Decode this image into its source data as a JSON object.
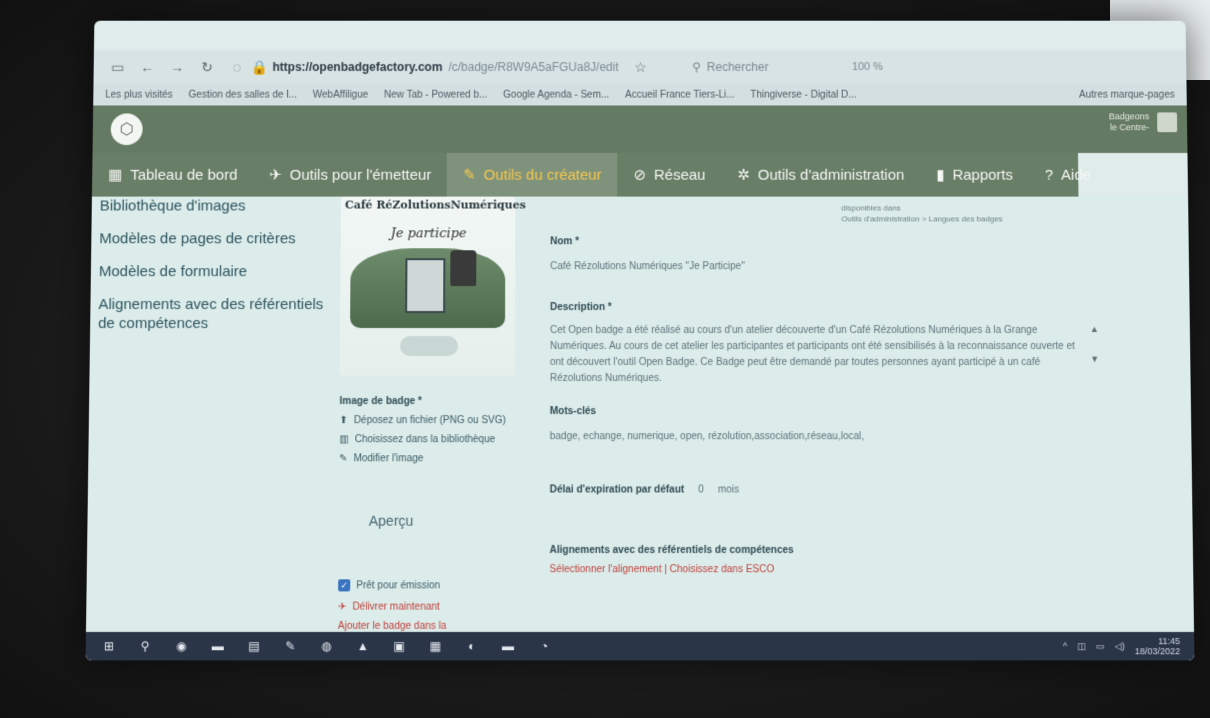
{
  "browser": {
    "url_host": "https://openbadgefactory.com",
    "url_path": "/c/badge/R8W9A5aFGUa8J/edit",
    "search_placeholder": "Rechercher",
    "zoom": "100 %",
    "bookmarks": [
      "Les plus visités",
      "Gestion des salles de l...",
      "WebAffiligue",
      "New Tab - Powered b...",
      "Google Agenda - Sem...",
      "Accueil France Tiers-Li...",
      "Thingiverse - Digital D..."
    ],
    "bookmarks_more": "Autres marque-pages"
  },
  "app": {
    "user_line1": "Badgeons",
    "user_line2": "le Centre-"
  },
  "nav": [
    {
      "icon": "▦",
      "label": "Tableau de bord",
      "active": false
    },
    {
      "icon": "✈",
      "label": "Outils pour l'émetteur",
      "active": false
    },
    {
      "icon": "✎",
      "label": "Outils du créateur",
      "active": true
    },
    {
      "icon": "⊘",
      "label": "Réseau",
      "active": false
    },
    {
      "icon": "✲",
      "label": "Outils d'administration",
      "active": false
    },
    {
      "icon": "▮",
      "label": "Rapports",
      "active": false
    },
    {
      "icon": "?",
      "label": "Aide",
      "active": false
    }
  ],
  "sidebar": [
    "Bibliothèque d'images",
    "Modèles de pages de critères",
    "Modèles de formulaire",
    "Alignements avec des référentiels de compétences"
  ],
  "badge": {
    "title": "Café RéZolutionsNumériques",
    "subtitle": "Je participe",
    "image_label": "Image de badge *",
    "upload": "Déposez un fichier (PNG ou SVG)",
    "library": "Choisissez dans la bibliothèque",
    "edit": "Modifier l'image",
    "preview": "Aperçu",
    "ready": "Prêt pour émission",
    "deliver": "Délivrer maintenant",
    "add": "Ajouter le badge dans la"
  },
  "form": {
    "note1": "disponibles dans",
    "note2": "Outils d'administration > Langues des badges",
    "name_label": "Nom *",
    "name_value": "Café Rézolutions Numériques \"Je Participe\"",
    "desc_label": "Description *",
    "desc_value": "Cet Open badge a été réalisé au cours d'un atelier découverte d'un Café Rézolutions Numériques à la Grange Numériques. Au cours de cet atelier les participantes et participants ont été sensibilisés à la reconnaissance ouverte et ont découvert l'outil Open Badge. Ce Badge peut être demandé par toutes personnes ayant participé à un café Rézolutions Numériques.",
    "keywords_label": "Mots-clés",
    "keywords_value": "badge, echange, numerique, open, rézolution,association,réseau,local,",
    "expiry_label": "Délai d'expiration par défaut",
    "expiry_value": "0",
    "expiry_unit": "mois",
    "align_label": "Alignements avec des référentiels de compétences",
    "align_links": "Sélectionner l'alignement | Choisissez dans ESCO"
  },
  "taskbar": {
    "time": "11:45",
    "date": "18/03/2022"
  }
}
